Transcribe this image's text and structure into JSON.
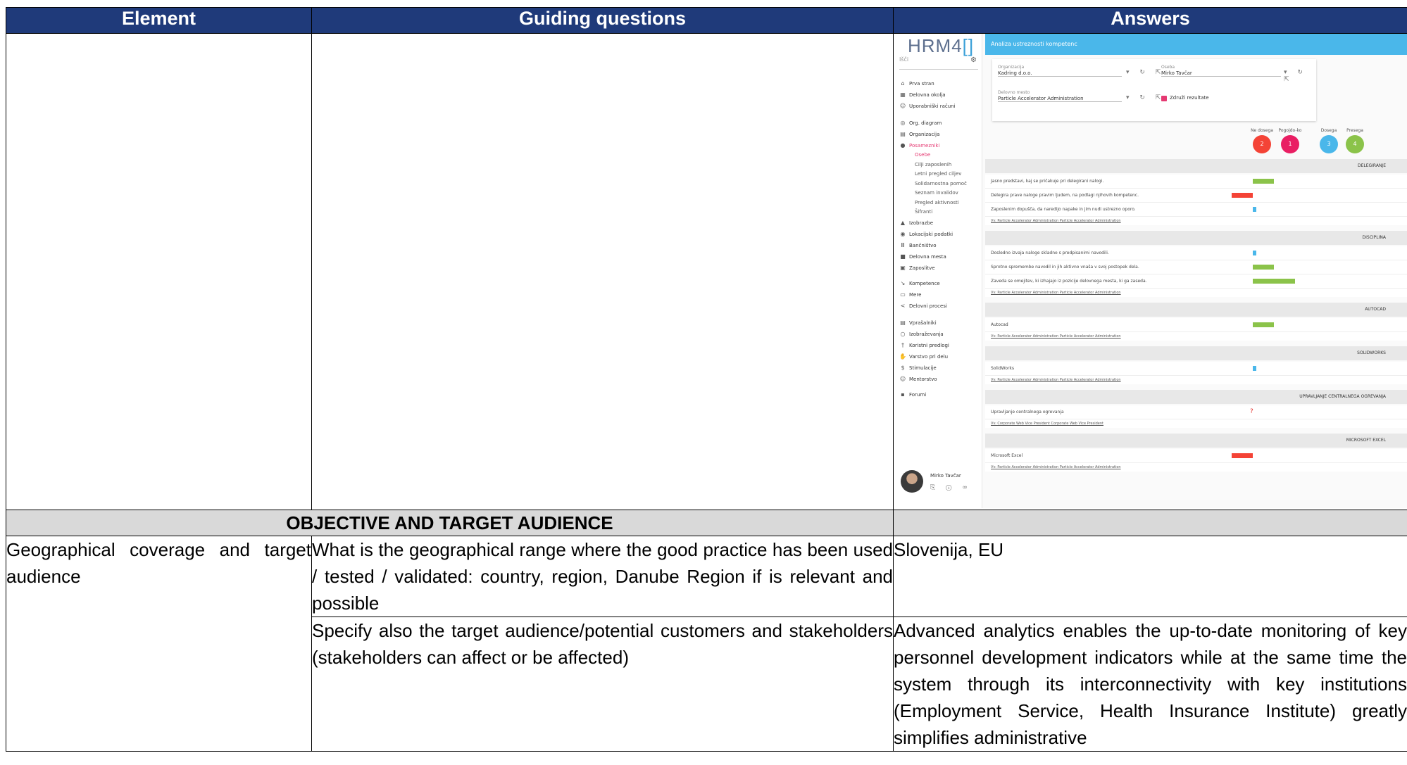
{
  "header": {
    "col1": "Element",
    "col2": "Guiding questions",
    "col3": "Answers"
  },
  "screenshot": {
    "logo_text": "HRM4",
    "topbar_title": "Analiza ustreznosti kompetenc",
    "search_placeholder": "Išči",
    "sidebar": {
      "items": [
        {
          "label": "Prva stran",
          "icon": "home-icon"
        },
        {
          "label": "Delovna okolja",
          "icon": "building-icon"
        },
        {
          "label": "Uporabniški računi",
          "icon": "users-icon"
        },
        {
          "label": "Org. diagram",
          "icon": "diagram-icon"
        },
        {
          "label": "Organizacija",
          "icon": "org-icon"
        },
        {
          "label": "Posamezniki",
          "icon": "person-icon"
        }
      ],
      "subitems": [
        "Osebe",
        "Cilji zaposlenih",
        "Letni pregled ciljev",
        "Solidarnostna pomoč",
        "Seznam invalidov",
        "Pregled aktivnosti",
        "Šifranti"
      ],
      "items2": [
        {
          "label": "Izobrazbe",
          "icon": "cap-icon"
        },
        {
          "label": "Lokacijski podatki",
          "icon": "pin-icon"
        },
        {
          "label": "Bančništvo",
          "icon": "bank-icon"
        },
        {
          "label": "Delovna mesta",
          "icon": "briefcase-icon"
        },
        {
          "label": "Zaposlitve",
          "icon": "suitcase-icon"
        },
        {
          "label": "Kompetence",
          "icon": "compass-icon"
        },
        {
          "label": "Mere",
          "icon": "ruler-icon"
        },
        {
          "label": "Delovni procesi",
          "icon": "share-icon"
        },
        {
          "label": "Vprašalniki",
          "icon": "form-icon"
        },
        {
          "label": "Izobraževanja",
          "icon": "bulb-icon"
        },
        {
          "label": "Koristni predlogi",
          "icon": "idea-icon"
        },
        {
          "label": "Varstvo pri delu",
          "icon": "hand-icon"
        },
        {
          "label": "Stimulacije",
          "icon": "dollar-icon"
        },
        {
          "label": "Mentorstvo",
          "icon": "mentor-icon"
        },
        {
          "label": "Forumi",
          "icon": "chat-icon"
        }
      ],
      "user_name": "Mirko Tavčar"
    },
    "filters": {
      "org_label": "Organizacija",
      "org_value": "Kadring d.o.o.",
      "person_label": "Oseba",
      "person_value": "Mirko Tavčar",
      "post_label": "Delovno mesto",
      "post_value": "Particle Accelerator Administration",
      "combine_label": "Združi rezultate"
    },
    "summary": [
      {
        "label": "Ne dosega",
        "count": "2",
        "color": "#f44336"
      },
      {
        "label": "Pogojdo-ko",
        "count": "1",
        "color": "#e91e63"
      },
      {
        "label": "Dosega",
        "count": "3",
        "color": "#4ab7ea"
      },
      {
        "label": "Presega",
        "count": "4",
        "color": "#8bc34a"
      }
    ],
    "sections": [
      {
        "title": "DELEGIRANJE",
        "rows": [
          {
            "q": "Jasno predstavi, kaj se pričakuje pri delegirani nalogi.",
            "color": "#8bc34a",
            "value": 0.4
          },
          {
            "q": "Delegira prave naloge pravim ljudem, na podlagi njihovih kompetenc.",
            "color": "#f44336",
            "value": -0.4
          },
          {
            "q": "Zaposlenim dopušča, da naredijo napake in jim nudi ustrezno oporo.",
            "color": "#4ab7ea",
            "value": 0.05
          }
        ],
        "vv": "Vv: Particle Accelerator Administration Particle Accelerator Administration"
      },
      {
        "title": "DISCIPLINA",
        "rows": [
          {
            "q": "Dosledno izvaja naloge skladno s predpisanimi navodili.",
            "color": "#4ab7ea",
            "value": 0.05
          },
          {
            "q": "Sprotno spremembe navodil in jih aktivno vnaša v svoj postopek dela.",
            "color": "#8bc34a",
            "value": 0.4
          },
          {
            "q": "Zaveda se omejitev, ki izhajajo iz pozicije delovnega mesta, ki ga zaseda.",
            "color": "#8bc34a",
            "value": 0.8
          }
        ],
        "vv": "Vv: Particle Accelerator Administration Particle Accelerator Administration"
      },
      {
        "title": "AUTOCAD",
        "rows": [
          {
            "q": "Autocad",
            "color": "#8bc34a",
            "value": 0.4
          }
        ],
        "vv": "Vv: Particle Accelerator Administration Particle Accelerator Administration"
      },
      {
        "title": "SOLIDWORKS",
        "rows": [
          {
            "q": "SolidWorks",
            "color": "#4ab7ea",
            "value": 0.05
          }
        ],
        "vv": "Vv: Particle Accelerator Administration Particle Accelerator Administration"
      },
      {
        "title": "UPRAVLJANJE CENTRALNEGA OGREVANJA",
        "rows": [
          {
            "q": "Upravljanje centralnega ogrevanja",
            "color": "#f44336",
            "value": null
          }
        ],
        "vv": "Vv: Corporate Web Vice President Corporate Web Vice President"
      },
      {
        "title": "MICROSOFT EXCEL",
        "rows": [
          {
            "q": "Microsoft Excel",
            "color": "#f44336",
            "value": -0.4
          }
        ],
        "vv": "Vv: Particle Accelerator Administration Particle Accelerator Administration"
      }
    ]
  },
  "section_heading": "OBJECTIVE AND TARGET AUDIENCE",
  "rows": {
    "element": "Geographical coverage and target audience",
    "q1": "What is the geographical range where the good practice has been used / tested / validated: country, region, Danube Region if is relevant and possible",
    "a1": "Slovenija, EU",
    "q2": "Specify also the target audience/potential customers and stakeholders (stakeholders can affect or be affected)",
    "a2": "Advanced analytics enables the up-to-date monitoring of key personnel development indicators while at the same time the system through its interconnectivity with key institutions (Employment Service, Health Insurance Institute) greatly simplifies administrative"
  }
}
